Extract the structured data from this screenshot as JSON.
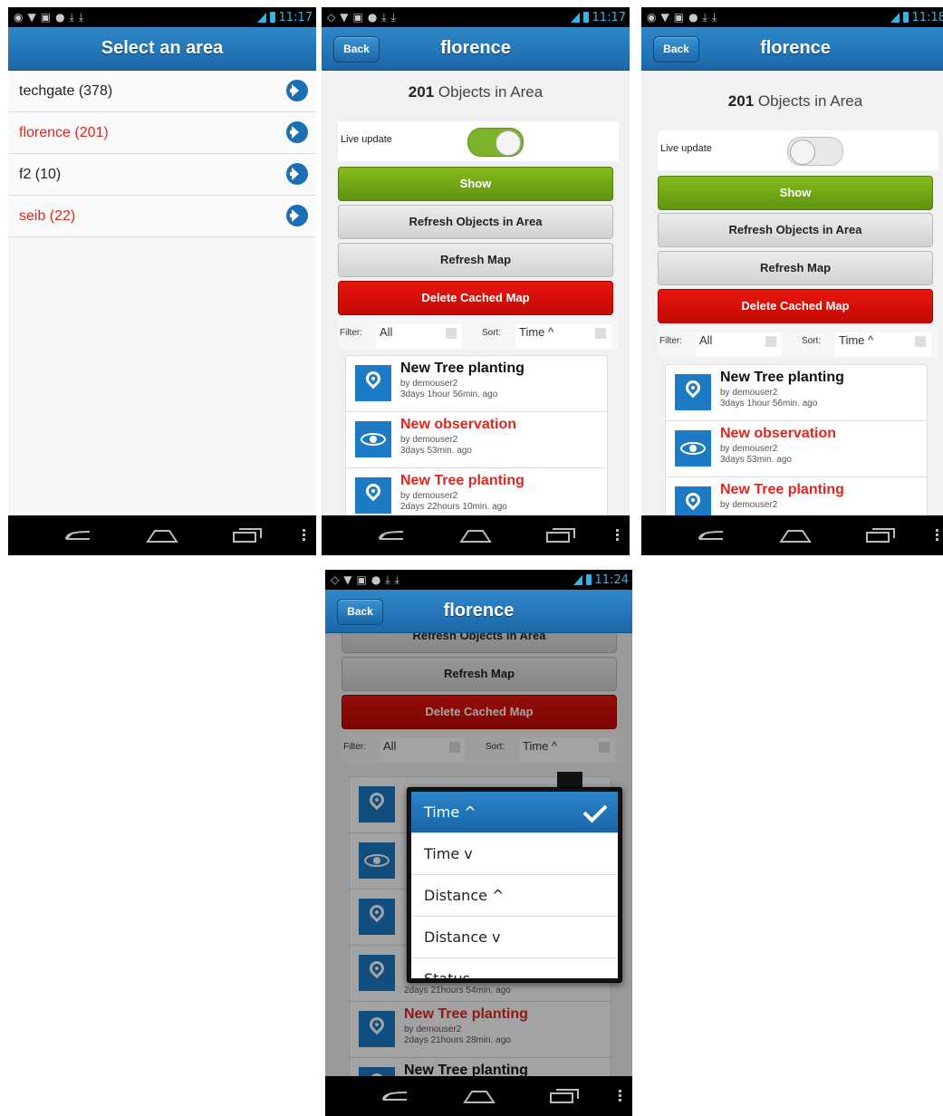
{
  "status_bar": {
    "times": [
      "11:17",
      "11:17",
      "11:18",
      "11:24"
    ],
    "network": "H"
  },
  "screen1": {
    "title": "Select an area",
    "areas": [
      {
        "label": "techgate (378)",
        "color": "#222222"
      },
      {
        "label": "florence (201)",
        "color": "#e0261f"
      },
      {
        "label": "f2 (10)",
        "color": "#222222"
      },
      {
        "label": "seib (22)",
        "color": "#e0261f"
      }
    ]
  },
  "area_screen": {
    "back_label": "Back",
    "title": "florence",
    "count_number": "201",
    "count_text": "Objects in Area",
    "live_update_label": "Live update",
    "live_update_on": true,
    "show_label": "Show",
    "refresh_objects_label": "Refresh Objects in Area",
    "refresh_map_label": "Refresh Map",
    "delete_cache_label": "Delete Cached Map",
    "filter_label": "Filter:",
    "filter_value": "All",
    "sort_label": "Sort:",
    "sort_value": "Time ^",
    "items": [
      {
        "title": "New Tree planting",
        "by": "by demouser2",
        "time": "3days 1hour 56min. ago",
        "icon": "pin-icon",
        "title_red": false
      },
      {
        "title": "New observation",
        "by": "by demouser2",
        "time": "3days 53min. ago",
        "icon": "eye-icon",
        "title_red": true
      },
      {
        "title": "New Tree planting",
        "by": "by demouser2",
        "time": "2days 22hours 10min. ago",
        "icon": "pin-icon",
        "title_red": true
      }
    ]
  },
  "screen4": {
    "visible_time_fragment": "2days 21hours 54min. ago",
    "items": [
      {
        "title": "New Tree planting",
        "by": "by demouser2",
        "time": "2days 21hours 28min. ago",
        "title_red": true
      },
      {
        "title": "New Tree planting",
        "title_red": false
      }
    ],
    "sort_options": [
      "Time ^",
      "Time v",
      "Distance ^",
      "Distance v",
      "Status"
    ],
    "selected_sort": "Time ^"
  },
  "colors": {
    "header_blue": "#1c67a8",
    "accent_red": "#e0261f",
    "show_green": "#6fa714",
    "delete_red": "#d5100a"
  }
}
